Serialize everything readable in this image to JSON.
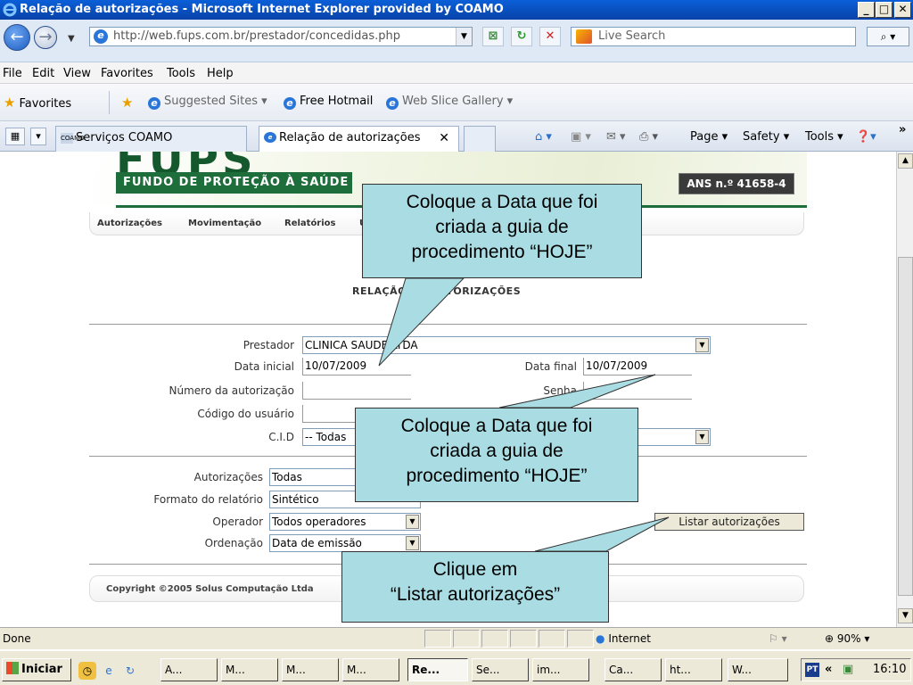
{
  "window": {
    "title": "Relação de autorizações - Microsoft Internet Explorer provided by COAMO",
    "minimize": "_",
    "maximize": "□",
    "close": "✕"
  },
  "addressbar": {
    "url": "http://web.fups.com.br/prestador/concedidas.php",
    "search_placeholder": "Live Search"
  },
  "menubar": [
    "File",
    "Edit",
    "View",
    "Favorites",
    "Tools",
    "Help"
  ],
  "favbar": {
    "favorites": "Favorites",
    "suggested": "Suggested Sites ▾",
    "hotmail": "Free Hotmail",
    "webslice": "Web Slice Gallery ▾"
  },
  "tabs": [
    {
      "label": "Serviços COAMO",
      "icon": "COAMO"
    },
    {
      "label": "Relação de autorizações"
    }
  ],
  "commandbar": {
    "page": "Page ▾",
    "safety": "Safety ▾",
    "tools": "Tools ▾"
  },
  "banner": {
    "logo": "FUPS",
    "tagline": "FUNDO DE PROTEÇÃO À SAÚDE",
    "ans": "ANS n.º 41658-4"
  },
  "nav": [
    "Autorizações",
    "Movimentação",
    "Relatórios",
    "U"
  ],
  "report_title": "RELAÇÃO DE AUTORIZAÇÕES",
  "form": {
    "prestador_label": "Prestador",
    "prestador_value": "CLINICA SAUDE LTDA",
    "data_inicial_label": "Data inicial",
    "data_inicial_value": "10/07/2009",
    "data_final_label": "Data final",
    "data_final_value": "10/07/2009",
    "numero_label": "Número da autorização",
    "senha_label": "Senha",
    "codigo_label": "Código do usuário",
    "cid_label": "C.I.D",
    "cid_value": "-- Todas",
    "autorizacoes_label": "Autorizações",
    "autorizacoes_value": "Todas",
    "formato_label": "Formato do relatório",
    "formato_value": "Sintético",
    "operador_label": "Operador",
    "operador_value": "Todos operadores",
    "ordenacao_label": "Ordenação",
    "ordenacao_value": "Data de emissão",
    "listar_button": "Listar autorizações"
  },
  "footer": "Copyright ©2005 Solus Computação Ltda",
  "callouts": {
    "top": "Coloque a Data que foi criada a guia de procedimento “HOJE”",
    "middle": "Coloque a Data que foi criada a guia de procedimento “HOJE”",
    "bottom_line1": "Clique em",
    "bottom_line2": "“Listar autorizações”"
  },
  "status": {
    "text": "Done",
    "zone": "Internet",
    "zoom": "90%"
  },
  "taskbar": {
    "start": "Iniciar",
    "tasks": [
      "A...",
      "M...",
      "M...",
      "M...",
      "Re...",
      "Se...",
      "im...",
      "Ca...",
      "ht...",
      "W..."
    ],
    "lang": "PT",
    "clock": "16:10"
  }
}
